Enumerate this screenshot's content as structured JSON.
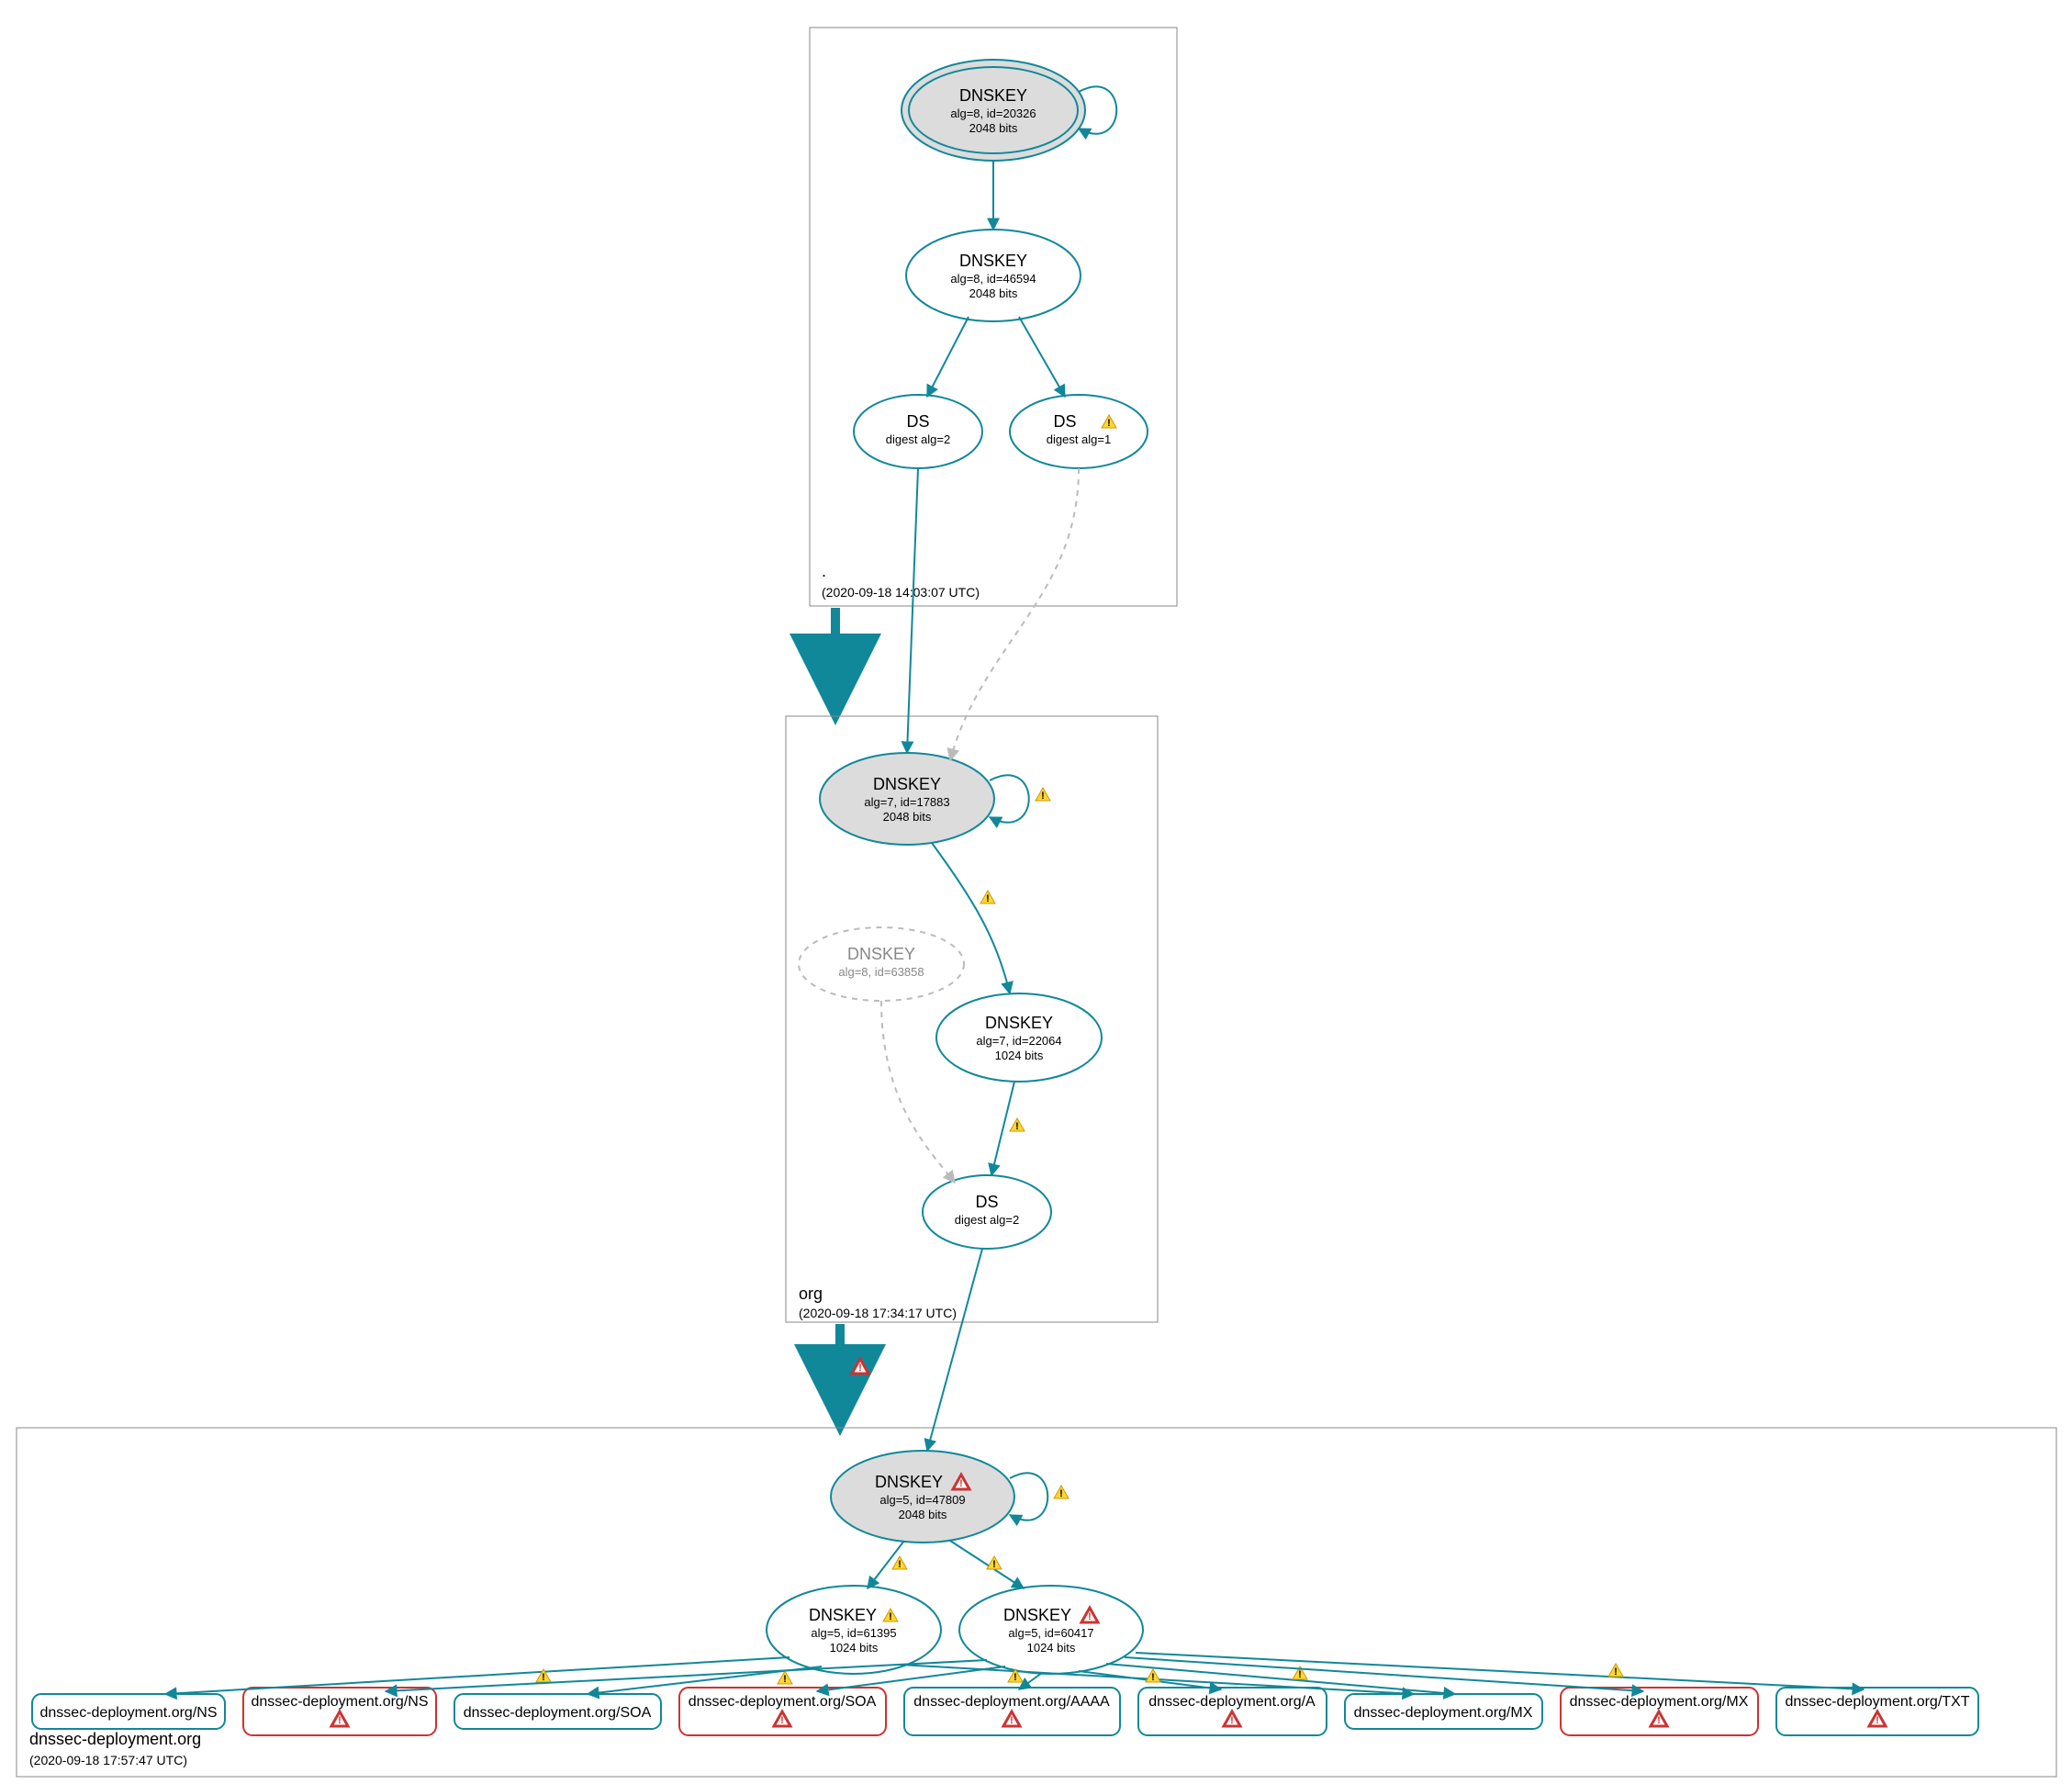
{
  "zones": {
    "root": {
      "label": ".",
      "timestamp": "(2020-09-18 14:03:07 UTC)"
    },
    "org": {
      "label": "org",
      "timestamp": "(2020-09-18 17:34:17 UTC)"
    },
    "leaf": {
      "label": "dnssec-deployment.org",
      "timestamp": "(2020-09-18 17:57:47 UTC)"
    }
  },
  "nodes": {
    "root_ksk": {
      "title": "DNSKEY",
      "sub1": "alg=8, id=20326",
      "sub2": "2048 bits"
    },
    "root_zsk": {
      "title": "DNSKEY",
      "sub1": "alg=8, id=46594",
      "sub2": "2048 bits"
    },
    "root_ds1": {
      "title": "DS",
      "sub1": "digest alg=2"
    },
    "root_ds2": {
      "title": "DS",
      "sub1": "digest alg=1"
    },
    "org_ksk": {
      "title": "DNSKEY",
      "sub1": "alg=7, id=17883",
      "sub2": "2048 bits"
    },
    "org_extra": {
      "title": "DNSKEY",
      "sub1": "alg=8, id=63858"
    },
    "org_zsk": {
      "title": "DNSKEY",
      "sub1": "alg=7, id=22064",
      "sub2": "1024 bits"
    },
    "org_ds": {
      "title": "DS",
      "sub1": "digest alg=2"
    },
    "leaf_ksk": {
      "title": "DNSKEY",
      "sub1": "alg=5, id=47809",
      "sub2": "2048 bits"
    },
    "leaf_zsk1": {
      "title": "DNSKEY",
      "sub1": "alg=5, id=61395",
      "sub2": "1024 bits"
    },
    "leaf_zsk2": {
      "title": "DNSKEY",
      "sub1": "alg=5, id=60417",
      "sub2": "1024 bits"
    }
  },
  "records": {
    "r0": "dnssec-deployment.org/NS",
    "r1": "dnssec-deployment.org/NS",
    "r2": "dnssec-deployment.org/SOA",
    "r3": "dnssec-deployment.org/SOA",
    "r4": "dnssec-deployment.org/AAAA",
    "r5": "dnssec-deployment.org/A",
    "r6": "dnssec-deployment.org/MX",
    "r7": "dnssec-deployment.org/MX",
    "r8": "dnssec-deployment.org/TXT"
  }
}
